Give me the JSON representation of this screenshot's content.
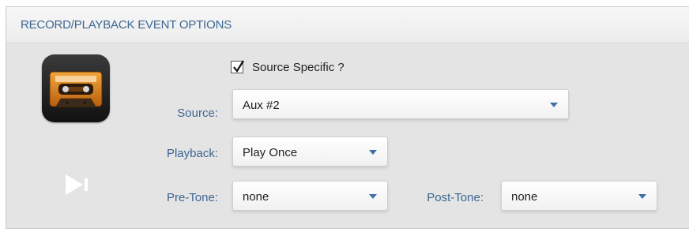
{
  "panel": {
    "title": "RECORD/PLAYBACK EVENT OPTIONS"
  },
  "source_specific": {
    "label": "Source Specific ?",
    "checked": true
  },
  "source": {
    "label": "Source:",
    "value": "Aux #2"
  },
  "playback": {
    "label": "Playback:",
    "value": "Play Once"
  },
  "pre_tone": {
    "label": "Pre-Tone:",
    "value": "none"
  },
  "post_tone": {
    "label": "Post-Tone:",
    "value": "none"
  },
  "icons": {
    "app": "cassette-tape-icon",
    "action": "play-next-icon"
  },
  "colors": {
    "label_blue": "#3d6691",
    "caret_blue": "#3f6fa6",
    "panel_bg": "#e4e4e4"
  }
}
